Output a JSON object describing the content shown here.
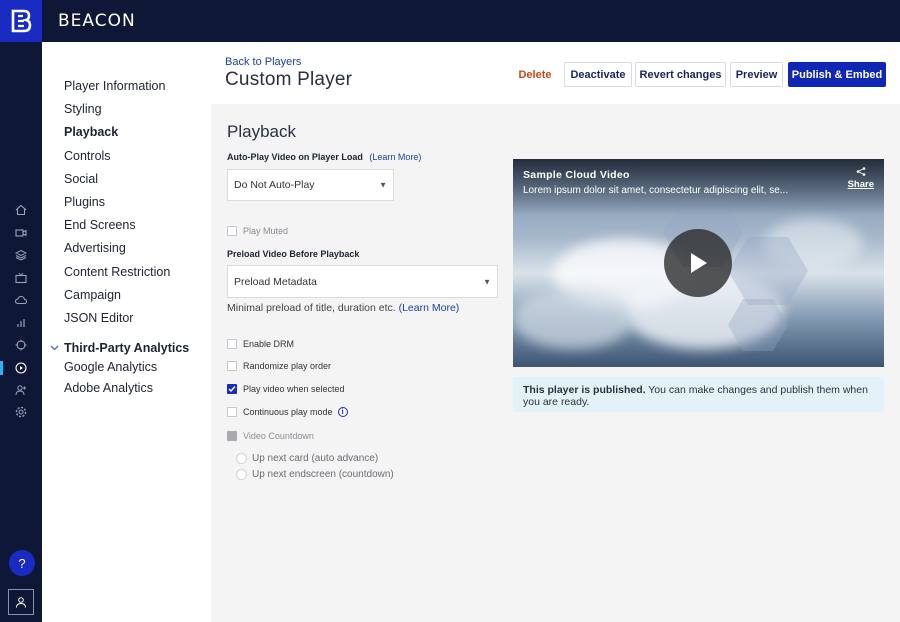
{
  "app": {
    "brand": "BEACON",
    "accent": "#1027b4"
  },
  "rail": {
    "icons": [
      "home-icon",
      "video-icon",
      "layers-icon",
      "tv-icon",
      "cloud-icon",
      "bar-chart-icon",
      "crosshair-icon",
      "play-circle-icon",
      "user-add-icon",
      "gear-icon"
    ],
    "help_label": "?"
  },
  "nav": {
    "items": [
      {
        "label": "Player Information"
      },
      {
        "label": "Styling"
      },
      {
        "label": "Playback"
      },
      {
        "label": "Controls"
      },
      {
        "label": "Social"
      },
      {
        "label": "Plugins"
      },
      {
        "label": "End Screens"
      },
      {
        "label": "Advertising"
      },
      {
        "label": "Content Restriction"
      },
      {
        "label": "Campaign"
      },
      {
        "label": "JSON Editor"
      }
    ],
    "group_label": "Third-Party Analytics",
    "group_items": [
      {
        "label": "Google Analytics"
      },
      {
        "label": "Adobe Analytics"
      }
    ]
  },
  "header": {
    "back_link": "Back to Players",
    "title": "Custom Player",
    "buttons": {
      "delete": "Delete",
      "deactivate": "Deactivate",
      "revert": "Revert changes",
      "preview": "Preview",
      "publish": "Publish & Embed"
    }
  },
  "playback": {
    "section_title": "Playback",
    "autoplay_label": "Auto-Play Video on Player Load",
    "autoplay_learn": "(Learn More)",
    "autoplay_value": "Do Not Auto-Play",
    "play_muted": "Play Muted",
    "preload_label": "Preload Video Before Playback",
    "preload_value": "Preload Metadata",
    "preload_hint": "Minimal preload of title, duration etc.",
    "preload_learn": "(Learn More)",
    "options": {
      "enable_drm": "Enable DRM",
      "randomize": "Randomize play order",
      "play_selected": "Play video when selected",
      "continuous": "Continuous play mode",
      "countdown": "Video Countdown",
      "up_next_card": "Up next card (auto advance)",
      "up_next_endscreen": "Up next endscreen (countdown)"
    }
  },
  "video": {
    "title": "Sample Cloud Video",
    "description": "Lorem ipsum dolor sit amet, consectetur adipiscing elit, se...",
    "share": "Share"
  },
  "notice": {
    "bold": "This player is published.",
    "text": " You can make changes and publish them when you are ready."
  }
}
